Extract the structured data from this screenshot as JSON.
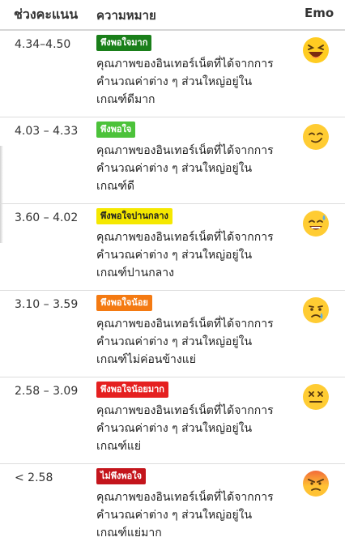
{
  "header": {
    "range": "ช่วงคะแนน",
    "meaning": "ความหมาย",
    "emo": "Emo"
  },
  "rows": [
    {
      "range": "4.34–4.50",
      "badge": "พึงพอใจมาก",
      "badge_bg": "#1a7f1a",
      "badge_fg": "#ffffff",
      "line1": "คุณภาพของอินเทอร์เน็ตที่ได้จากการ",
      "line2": "คำนวณค่าต่าง ๆ ส่วนใหญ่อยู่ใน",
      "line3": "เกณฑ์ดีมาก",
      "emo": "laughing-face-icon"
    },
    {
      "range": "4.03 – 4.33",
      "badge": "พึงพอใจ",
      "badge_bg": "#4cc23a",
      "badge_fg": "#ffffff",
      "line1": "คุณภาพของอินเทอร์เน็ตที่ได้จากการ",
      "line2": "คำนวณค่าต่าง ๆ ส่วนใหญ่อยู่ใน",
      "line3": "เกณฑ์ดี",
      "emo": "smiling-face-icon"
    },
    {
      "range": "3.60 – 4.02",
      "badge": "พึงพอใจปานกลาง",
      "badge_bg": "#f5e800",
      "badge_fg": "#222222",
      "line1": "คุณภาพของอินเทอร์เน็ตที่ได้จากการ",
      "line2": "คำนวณค่าต่าง ๆ ส่วนใหญ่อยู่ใน",
      "line3": "เกณฑ์ปานกลาง",
      "emo": "sweat-smile-face-icon"
    },
    {
      "range": "3.10 – 3.59",
      "badge": "พึงพอใจน้อย",
      "badge_bg": "#f47a12",
      "badge_fg": "#ffffff",
      "line1": "คุณภาพของอินเทอร์เน็ตที่ได้จากการ",
      "line2": "คำนวณค่าต่าง ๆ ส่วนใหญ่อยู่ใน",
      "line3": "เกณฑ์ไม่ค่อนข้างแย่",
      "emo": "crying-face-icon"
    },
    {
      "range": "2.58 – 3.09",
      "badge": "พึงพอใจน้อยมาก",
      "badge_bg": "#e52020",
      "badge_fg": "#ffffff",
      "line1": "คุณภาพของอินเทอร์เน็ตที่ได้จากการ",
      "line2": "คำนวณค่าต่าง ๆ ส่วนใหญ่อยู่ใน",
      "line3": "เกณฑ์แย่",
      "emo": "dizzy-face-icon"
    },
    {
      "range": "< 2.58",
      "badge": "ไม่พึงพอใจ",
      "badge_bg": "#c4151c",
      "badge_fg": "#ffffff",
      "line1": "คุณภาพของอินเทอร์เน็ตที่ได้จากการ",
      "line2": "คำนวณค่าต่าง ๆ ส่วนใหญ่อยู่ใน",
      "line3": "เกณฑ์แย่มาก",
      "emo": "angry-face-icon"
    }
  ]
}
